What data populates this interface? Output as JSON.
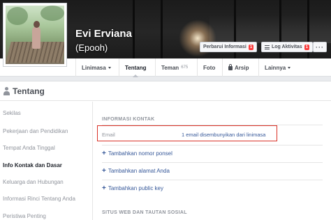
{
  "profile": {
    "name": "Evi Erviana",
    "nickname": "(Epooh)"
  },
  "header_buttons": {
    "update_label": "Perbarui Informasi",
    "update_badge": "1",
    "log_label": "Log Aktivitas",
    "log_badge": "1",
    "more_label": "···"
  },
  "tabs": [
    {
      "label": "Linimasa",
      "has_dropdown": true
    },
    {
      "label": "Tentang",
      "active": true
    },
    {
      "label": "Teman",
      "count": "675"
    },
    {
      "label": "Foto"
    },
    {
      "label": "Arsip",
      "icon": "lock-icon"
    },
    {
      "label": "Lainnya",
      "has_dropdown": true
    }
  ],
  "about": {
    "title": "Tentang",
    "sidebar": [
      "Sekilas",
      "Pekerjaan dan Pendidikan",
      "Tempat Anda Tinggal",
      "Info Kontak dan Dasar",
      "Keluarga dan Hubungan",
      "Informasi Rinci Tentang Anda",
      "Peristiwa Penting"
    ],
    "active_item": "Info Kontak dan Dasar"
  },
  "contact": {
    "section_title": "INFORMASI KONTAK",
    "email_label": "Email",
    "email_value": "1 email disembunyikan dari linimasa",
    "add_links": [
      "Tambahkan nomor ponsel",
      "Tambahkan alamat Anda",
      "Tambahkan public key"
    ],
    "web_section_title": "SITUS WEB DAN TAUTAN SOSIAL"
  },
  "colors": {
    "link": "#365899",
    "badge": "#fa3e3e",
    "highlight_box": "#d93025"
  }
}
